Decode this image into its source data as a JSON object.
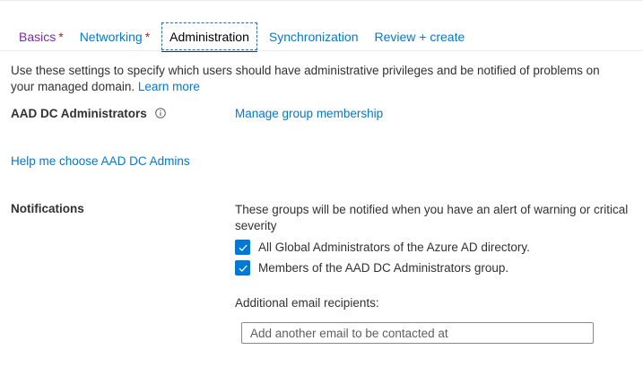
{
  "tabs": [
    {
      "label": "Basics",
      "required": "*"
    },
    {
      "label": "Networking",
      "required": "*"
    },
    {
      "label": "Administration"
    },
    {
      "label": "Synchronization"
    },
    {
      "label": "Review + create"
    }
  ],
  "intro": {
    "text": "Use these settings to specify which users should have administrative privileges and be notified of problems on your managed domain.",
    "learn_more": "Learn more"
  },
  "admins": {
    "label": "AAD DC Administrators",
    "info_icon": "info-icon",
    "manage_link": "Manage group membership",
    "help_link": "Help me choose AAD DC Admins"
  },
  "notifications": {
    "label": "Notifications",
    "description": "These groups will be notified when you have an alert of warning or critical severity",
    "options": [
      {
        "label": "All Global Administrators of the Azure AD directory.",
        "checked": true
      },
      {
        "label": "Members of the AAD DC Administrators group.",
        "checked": true
      }
    ],
    "additional_label": "Additional email recipients:",
    "email_placeholder": "Add another email to be contacted at",
    "email_value": ""
  },
  "colors": {
    "accent": "#0078d4",
    "visited": "#7b2c9a",
    "required": "#a4262c",
    "text": "#323130"
  }
}
